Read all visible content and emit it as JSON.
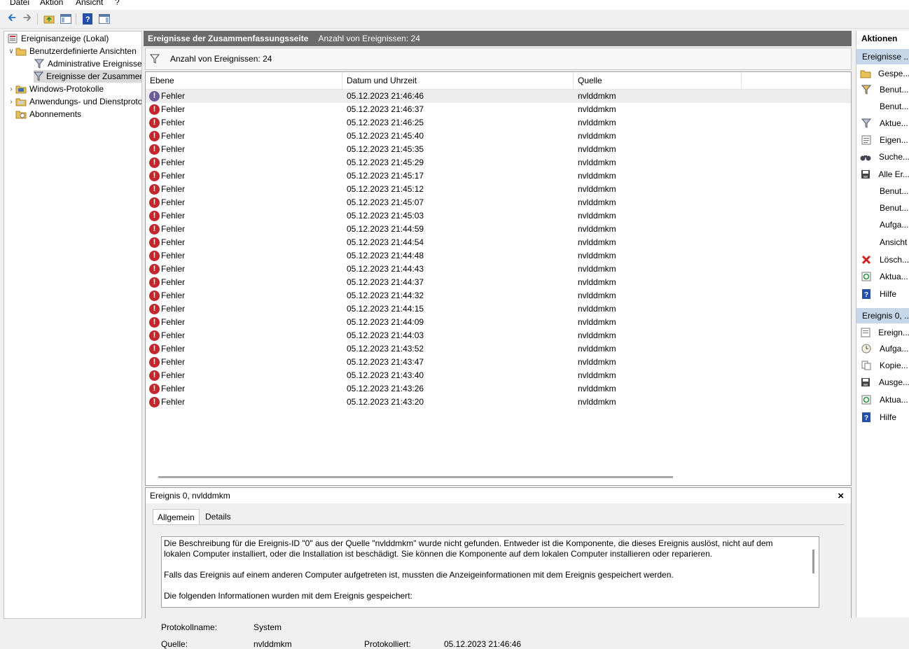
{
  "menu": {
    "datei": "Datei",
    "aktion": "Aktion",
    "ansicht": "Ansicht",
    "help": "?"
  },
  "tree": {
    "root": "Ereignisanzeige (Lokal)",
    "custom_views": "Benutzerdefinierte Ansichten",
    "admin_events": "Administrative Ereignisse",
    "summary_events": "Ereignisse der Zusammenfassungsseite",
    "windows_logs": "Windows-Protokolle",
    "app_service_logs": "Anwendungs- und Dienstprotokolle",
    "subscriptions": "Abonnements"
  },
  "header": {
    "title": "Ereignisse der Zusammenfassungsseite",
    "count": "Anzahl von Ereignissen: 24"
  },
  "filter": {
    "text": "Anzahl von Ereignissen: 24"
  },
  "columns": {
    "level": "Ebene",
    "datetime": "Datum und Uhrzeit",
    "source": "Quelle"
  },
  "events": [
    {
      "level": "Fehler",
      "datetime": "05.12.2023 21:46:46",
      "source": "nvlddmkm"
    },
    {
      "level": "Fehler",
      "datetime": "05.12.2023 21:46:37",
      "source": "nvlddmkm"
    },
    {
      "level": "Fehler",
      "datetime": "05.12.2023 21:46:25",
      "source": "nvlddmkm"
    },
    {
      "level": "Fehler",
      "datetime": "05.12.2023 21:45:40",
      "source": "nvlddmkm"
    },
    {
      "level": "Fehler",
      "datetime": "05.12.2023 21:45:35",
      "source": "nvlddmkm"
    },
    {
      "level": "Fehler",
      "datetime": "05.12.2023 21:45:29",
      "source": "nvlddmkm"
    },
    {
      "level": "Fehler",
      "datetime": "05.12.2023 21:45:17",
      "source": "nvlddmkm"
    },
    {
      "level": "Fehler",
      "datetime": "05.12.2023 21:45:12",
      "source": "nvlddmkm"
    },
    {
      "level": "Fehler",
      "datetime": "05.12.2023 21:45:07",
      "source": "nvlddmkm"
    },
    {
      "level": "Fehler",
      "datetime": "05.12.2023 21:45:03",
      "source": "nvlddmkm"
    },
    {
      "level": "Fehler",
      "datetime": "05.12.2023 21:44:59",
      "source": "nvlddmkm"
    },
    {
      "level": "Fehler",
      "datetime": "05.12.2023 21:44:54",
      "source": "nvlddmkm"
    },
    {
      "level": "Fehler",
      "datetime": "05.12.2023 21:44:48",
      "source": "nvlddmkm"
    },
    {
      "level": "Fehler",
      "datetime": "05.12.2023 21:44:43",
      "source": "nvlddmkm"
    },
    {
      "level": "Fehler",
      "datetime": "05.12.2023 21:44:37",
      "source": "nvlddmkm"
    },
    {
      "level": "Fehler",
      "datetime": "05.12.2023 21:44:32",
      "source": "nvlddmkm"
    },
    {
      "level": "Fehler",
      "datetime": "05.12.2023 21:44:15",
      "source": "nvlddmkm"
    },
    {
      "level": "Fehler",
      "datetime": "05.12.2023 21:44:09",
      "source": "nvlddmkm"
    },
    {
      "level": "Fehler",
      "datetime": "05.12.2023 21:44:03",
      "source": "nvlddmkm"
    },
    {
      "level": "Fehler",
      "datetime": "05.12.2023 21:43:52",
      "source": "nvlddmkm"
    },
    {
      "level": "Fehler",
      "datetime": "05.12.2023 21:43:47",
      "source": "nvlddmkm"
    },
    {
      "level": "Fehler",
      "datetime": "05.12.2023 21:43:40",
      "source": "nvlddmkm"
    },
    {
      "level": "Fehler",
      "datetime": "05.12.2023 21:43:26",
      "source": "nvlddmkm"
    },
    {
      "level": "Fehler",
      "datetime": "05.12.2023 21:43:20",
      "source": "nvlddmkm"
    }
  ],
  "detail": {
    "title": "Ereignis 0, nvlddmkm",
    "close": "×",
    "tab_general": "Allgemein",
    "tab_details": "Details",
    "desc1": "Die Beschreibung für die Ereignis-ID \"0\" aus der Quelle \"nvlddmkm\" wurde nicht gefunden. Entweder ist die Komponente, die dieses Ereignis auslöst, nicht auf dem lokalen Computer installiert, oder die Installation ist beschädigt. Sie können die Komponente auf dem lokalen Computer installieren oder reparieren.",
    "desc2": "Falls das Ereignis auf einem anderen Computer aufgetreten ist, mussten die Anzeigeinformationen mit dem Ereignis gespeichert werden.",
    "desc3": "Die folgenden Informationen wurden mit dem Ereignis gespeichert:",
    "log_name_label": "Protokollname:",
    "log_name_value": "System",
    "source_label": "Quelle:",
    "source_value": "nvlddmkm",
    "logged_label": "Protokolliert:",
    "logged_value": "05.12.2023 21:46:46"
  },
  "actions": {
    "title": "Aktionen",
    "section1": "Ereignisse ...",
    "items1": [
      "Gespe...",
      "Benut...",
      "Benut...",
      "Aktue...",
      "Eigen...",
      "Suche...",
      "Alle Er...",
      "Benut...",
      "Benut...",
      "Aufga...",
      "Ansicht",
      "Lösch...",
      "Aktua...",
      "Hilfe"
    ],
    "section2": "Ereignis 0, ...",
    "items2": [
      "Ereign...",
      "Aufga...",
      "Kopie...",
      "Ausge...",
      "Aktua...",
      "Hilfe"
    ]
  },
  "colors": {
    "header_bg": "#6b6b6b",
    "error_red": "#c4262e",
    "action_section": "#c6d7ea"
  }
}
